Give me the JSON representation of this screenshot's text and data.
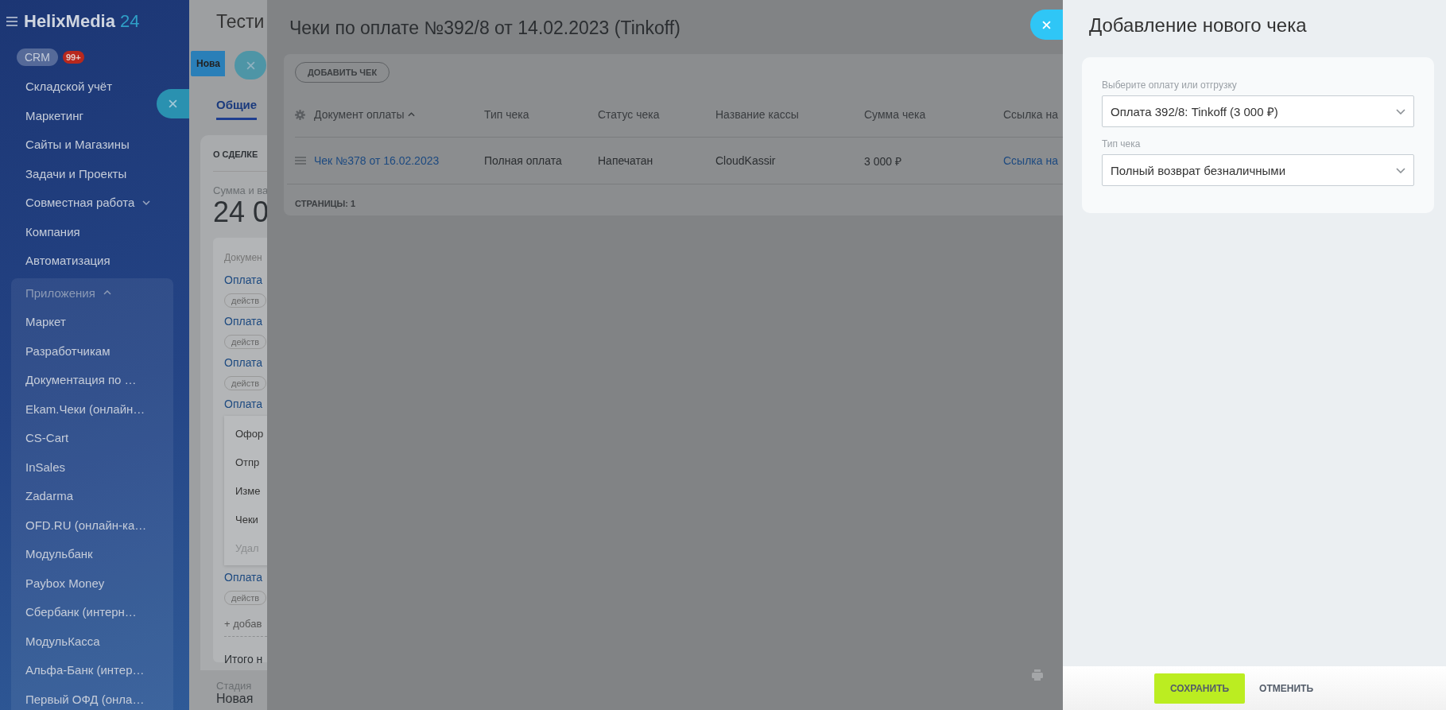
{
  "sidebar": {
    "logo": {
      "name": "HelixMedia",
      "suffix": "24"
    },
    "items": [
      {
        "label": "CRM",
        "kind": "pill",
        "badge": "99+"
      },
      {
        "label": "Складской учёт",
        "kind": "link"
      },
      {
        "label": "Маркетинг",
        "kind": "link"
      },
      {
        "label": "Сайты и Магазины",
        "kind": "link"
      },
      {
        "label": "Задачи и Проекты",
        "kind": "link"
      },
      {
        "label": "Совместная работа",
        "kind": "group",
        "expanded": false
      },
      {
        "label": "Компания",
        "kind": "link"
      },
      {
        "label": "Автоматизация",
        "kind": "link"
      }
    ],
    "apps_group": {
      "label": "Приложения",
      "expanded": true,
      "items": [
        "Маркет",
        "Разработчикам",
        "Документация по …",
        "Ekam.Чеки (онлайн…",
        "CS-Cart",
        "InSales",
        "Zadarma",
        "OFD.RU (онлайн-ка…",
        "Модульбанк",
        "Paybox Money",
        "Сбербанк (интерн…",
        "МодульКасса",
        "Альфа-Банк (интер…",
        "Первый ОФД (онла…"
      ]
    }
  },
  "deal_page": {
    "title": "Тести",
    "stage_button": "Нова",
    "tabs": [
      {
        "label": "Общие",
        "selected": true
      }
    ],
    "section_title": "О СДЕЛКЕ",
    "amount_label": "Сумма и ва",
    "amount": "24 0",
    "documents_label": "Докумен",
    "payments": [
      {
        "link": "Оплата",
        "status": "действ"
      },
      {
        "link": "Оплата",
        "status": "действ"
      },
      {
        "link": "Оплата",
        "status": "действ"
      },
      {
        "link": "Оплата"
      }
    ],
    "context_menu": [
      {
        "label": "Офор",
        "disabled": false
      },
      {
        "label": "Отпр",
        "disabled": false
      },
      {
        "label": "Изме",
        "disabled": false
      },
      {
        "label": "Чеки",
        "disabled": false
      },
      {
        "label": "Удал",
        "disabled": true
      }
    ],
    "payments_after": [
      {
        "link": "Оплата",
        "status": "действ"
      }
    ],
    "add_link": "+ добав",
    "total": "Итого н",
    "stage_label": "Стадия",
    "stage_value": "Новая"
  },
  "receipts_modal": {
    "title": "Чеки по оплате №392/8 от 14.02.2023 (Tinkoff)",
    "add_button": "ДОБАВИТЬ ЧЕК",
    "table": {
      "columns": [
        {
          "label": "Документ оплаты",
          "sorted": true
        },
        {
          "label": "Тип чека",
          "sorted": false
        },
        {
          "label": "Статус чека",
          "sorted": false
        },
        {
          "label": "Название кассы",
          "sorted": false
        },
        {
          "label": "Сумма чека",
          "sorted": false
        },
        {
          "label": "Ссылка на",
          "sorted": false
        }
      ],
      "rows": [
        {
          "document": "Чек №378 от 16.02.2023",
          "type": "Полная оплата",
          "status": "Напечатан",
          "register": "CloudKassir",
          "amount": "3 000 ₽",
          "link": "Ссылка на"
        }
      ]
    },
    "pages_label": "СТРАНИЦЫ:",
    "pages": "1"
  },
  "new_receipt_panel": {
    "title": "Добавление нового чека",
    "fields": [
      {
        "label": "Выберите оплату или отгрузку",
        "value": "Оплата 392/8: Tinkoff (3 000 ₽)"
      },
      {
        "label": "Тип чека",
        "value": "Полный возврат безналичными"
      }
    ],
    "buttons": [
      {
        "label": "СОХРАНИТЬ",
        "kind": "primary"
      },
      {
        "label": "ОТМЕНИТЬ",
        "kind": "link"
      }
    ]
  }
}
